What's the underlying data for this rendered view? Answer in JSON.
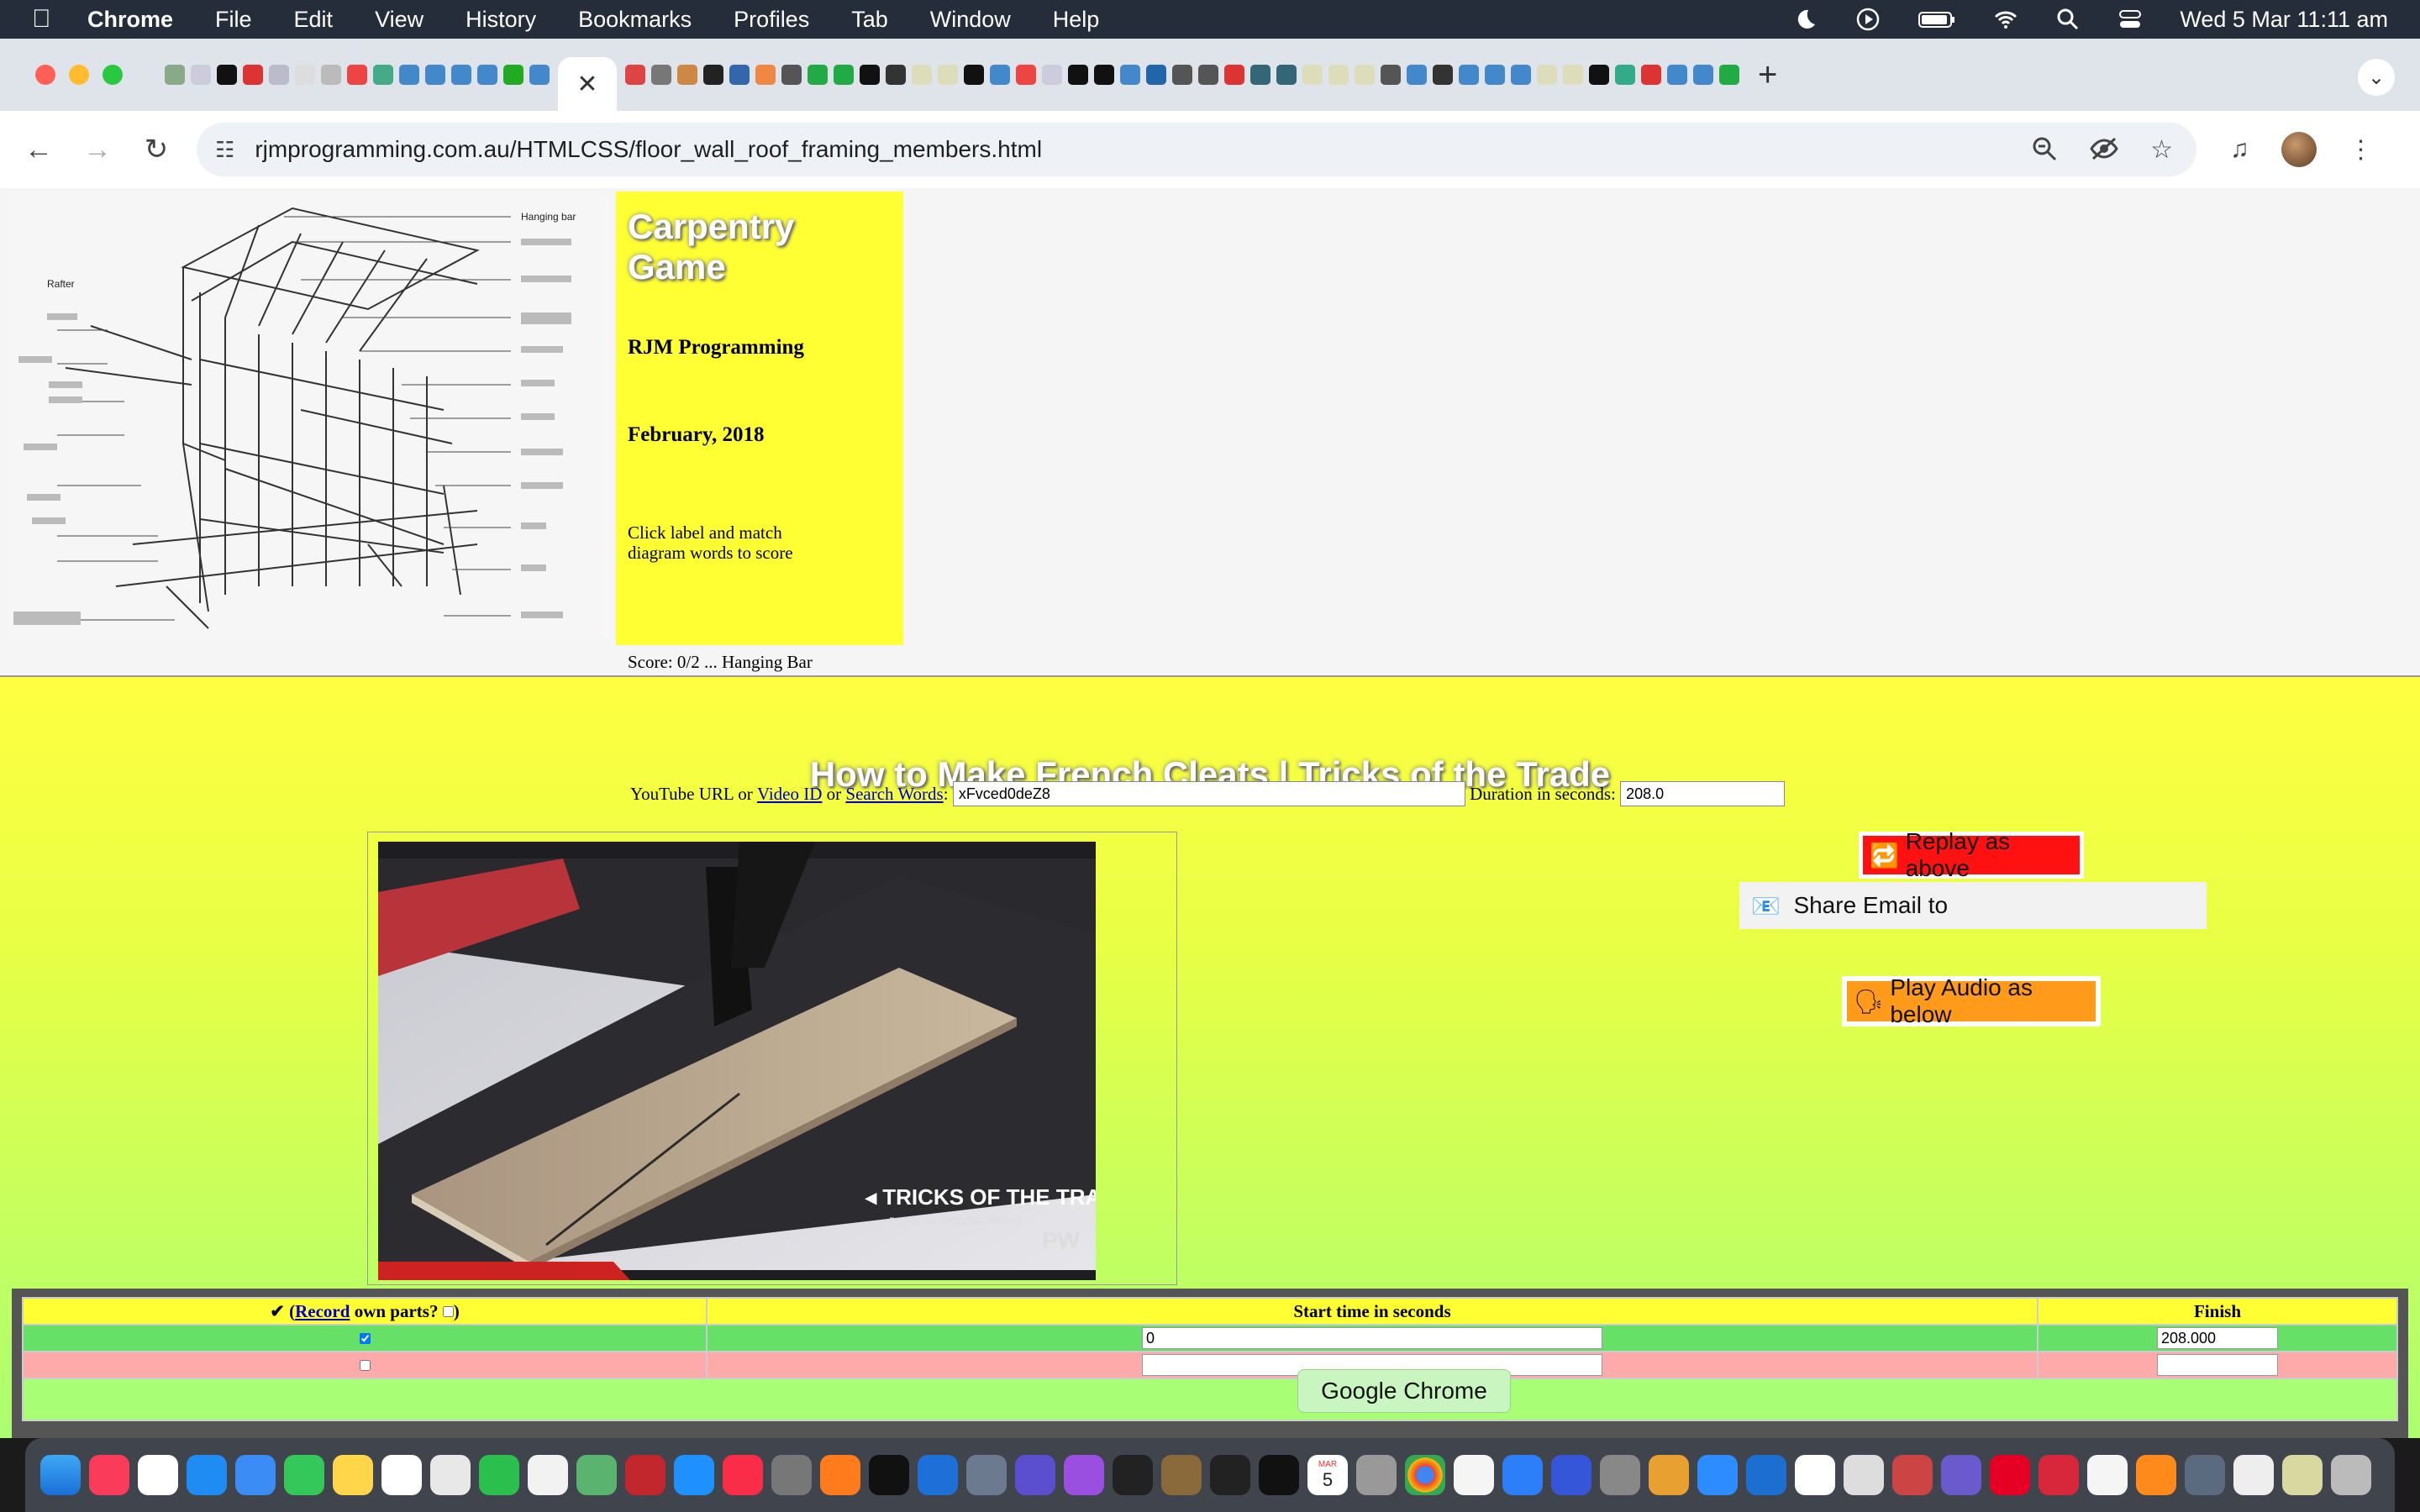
{
  "menubar": {
    "app_name": "Chrome",
    "items": [
      "File",
      "Edit",
      "View",
      "History",
      "Bookmarks",
      "Profiles",
      "Tab",
      "Window",
      "Help"
    ],
    "clock": "Wed 5 Mar  11:11 am"
  },
  "browser": {
    "active_tab_close": "✕",
    "new_tab": "+",
    "url": "rjmprogramming.com.au/HTMLCSS/floor_wall_roof_framing_members.html"
  },
  "game": {
    "diagram_labels": {
      "hanging_bar": "Hanging bar",
      "rafter": "Rafter"
    },
    "title": "Carpentry Game",
    "author": "RJM Programming",
    "date": "February, 2018",
    "instructions": "Click label and match diagram words to score",
    "score": "Score: 0/2 ... Hanging Bar"
  },
  "video": {
    "title": "How to Make French Cleats | Tricks of the Trade",
    "url_label_prefix": "YouTube URL or",
    "video_id_link": "Video ID",
    "or_text": "or",
    "search_words_link": "Search Words",
    "url_value": "xFvced0deZ8",
    "duration_label": "Duration in seconds:",
    "duration_value": "208.0",
    "watermark": "◂ TRICKS OF THE TRADE ▸",
    "watermark_sub": "POPULAR WOODWORKING",
    "watermark_logo": "PW"
  },
  "actions": {
    "replay": "Replay as above",
    "share": "Share Email to",
    "audio": "Play Audio as below"
  },
  "parts_table": {
    "col1_prefix": "✔ (",
    "col1_link": "Record",
    "col1_suffix": "own parts?",
    "col1_close": ")",
    "col2": "Start time in seconds",
    "col3": "Finish",
    "rows": [
      {
        "checked": true,
        "start": "0",
        "finish": "208.000"
      },
      {
        "checked": false,
        "start": "",
        "finish": ""
      }
    ]
  },
  "tooltip": "Google Chrome",
  "dock": {
    "calendar_day": "5",
    "calendar_month": "MAR"
  },
  "colors": {
    "info_panel": "#ffff33",
    "replay_button": "#ff1111",
    "audio_button": "#ff9a1a",
    "row_green": "#66e066",
    "row_pink": "#ffaaaa"
  }
}
